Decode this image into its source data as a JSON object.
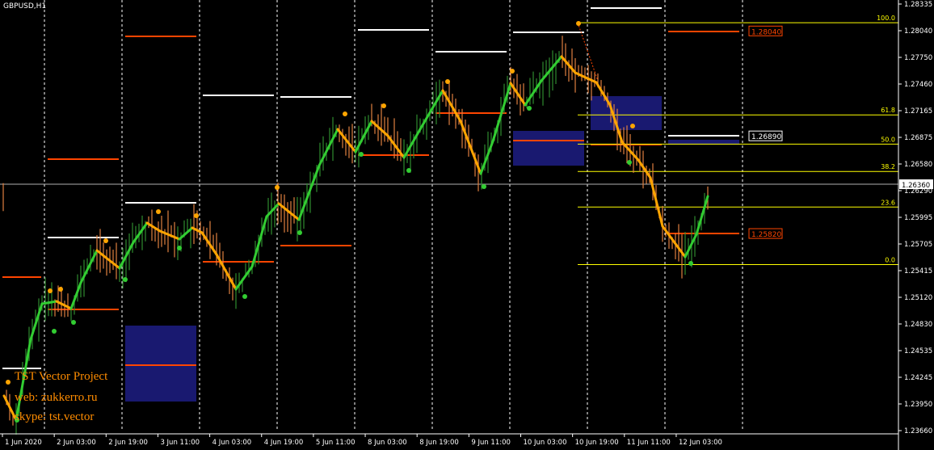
{
  "symbol": "GBPUSD,H1",
  "watermark": {
    "line1": "TST Vector Project",
    "line2": "web: zukkerro.ru",
    "line3": "skype: tst.vector"
  },
  "chart_data": {
    "type": "candlestick",
    "price_axis": {
      "min": 1.2366,
      "max": 1.28335,
      "ticks": [
        "1.28335",
        "1.28040",
        "1.27750",
        "1.27460",
        "1.27165",
        "1.26875",
        "1.26580",
        "1.26290",
        "1.25995",
        "1.25705",
        "1.25415",
        "1.25120",
        "1.24830",
        "1.24535",
        "1.24245",
        "1.23950",
        "1.23660"
      ]
    },
    "time_axis": {
      "labels": [
        "1 Jun 2020",
        "2 Jun 03:00",
        "2 Jun 19:00",
        "3 Jun 11:00",
        "4 Jun 03:00",
        "4 Jun 19:00",
        "5 Jun 11:00",
        "8 Jun 03:00",
        "8 Jun 19:00",
        "9 Jun 11:00",
        "10 Jun 03:00",
        "10 Jun 19:00",
        "11 Jun 11:00",
        "12 Jun 03:00"
      ]
    },
    "current_price": "1.26360",
    "price_labels": [
      {
        "text": "1.28040",
        "price": 1.2804,
        "color": "#ff4500"
      },
      {
        "text": "1.26890",
        "price": 1.2689,
        "color": "#ffffff"
      },
      {
        "text": "1.25820",
        "price": 1.2582,
        "color": "#ff4500"
      }
    ],
    "fibonacci": [
      {
        "level": "100.0",
        "price": 1.2813
      },
      {
        "level": "61.8",
        "price": 1.2712
      },
      {
        "level": "50.0",
        "price": 1.268
      },
      {
        "level": "38.2",
        "price": 1.265
      },
      {
        "level": "23.6",
        "price": 1.2611
      },
      {
        "level": "0.0",
        "price": 1.2548
      }
    ],
    "colors": {
      "background": "#000000",
      "up_wave": "#32cd32",
      "down_wave": "#ffa500",
      "resistance": "#ffffff",
      "support": "#ff4500",
      "fib": "#ffff00",
      "zone": "#191970",
      "grid": "#ffffff"
    }
  }
}
